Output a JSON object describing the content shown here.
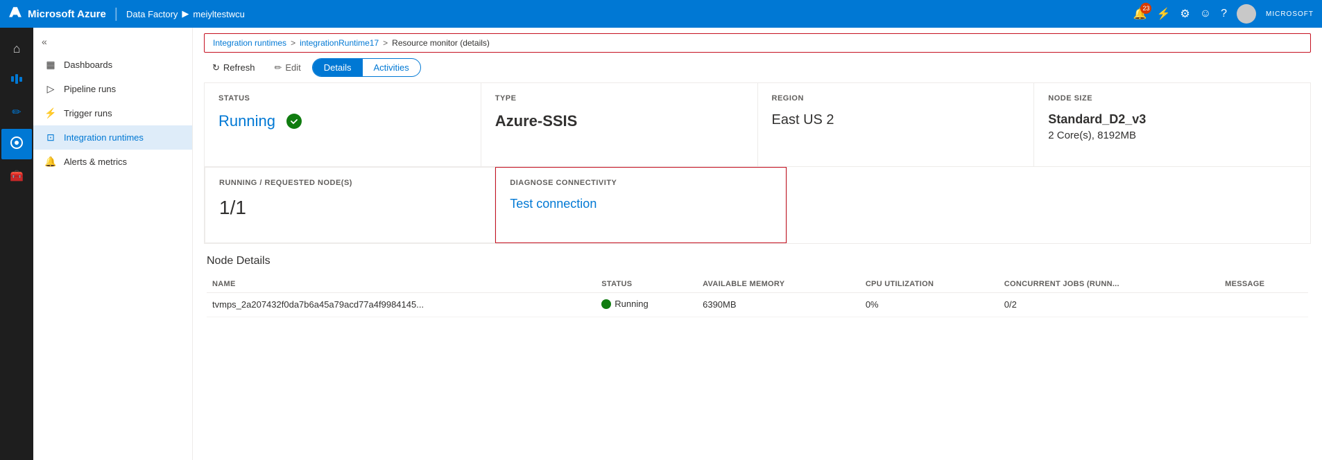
{
  "topbar": {
    "brand": "Microsoft Azure",
    "separator": "|",
    "breadcrumb1": "Data Factory",
    "arrow": "▶",
    "breadcrumb2": "meiyltestwcu",
    "notification_count": "23",
    "microsoft_label": "MICROSOFT"
  },
  "sidebar_icons": [
    {
      "id": "home",
      "label": "Home",
      "icon": "⊞",
      "active": false
    },
    {
      "id": "data-factory",
      "label": "Data Factory",
      "icon": "🏭",
      "active": false
    },
    {
      "id": "author",
      "label": "Author",
      "icon": "✏️",
      "active": false
    },
    {
      "id": "monitor",
      "label": "Monitor",
      "icon": "🔵",
      "active": true
    },
    {
      "id": "manage",
      "label": "Manage",
      "icon": "🧰",
      "active": false
    }
  ],
  "left_nav": {
    "collapse_label": "«",
    "items": [
      {
        "id": "dashboards",
        "label": "Dashboards",
        "icon": "▦",
        "active": false
      },
      {
        "id": "pipeline-runs",
        "label": "Pipeline runs",
        "icon": "▷",
        "active": false
      },
      {
        "id": "trigger-runs",
        "label": "Trigger runs",
        "icon": "⚡",
        "active": false
      },
      {
        "id": "integration-runtimes",
        "label": "Integration runtimes",
        "icon": "⊡",
        "active": true
      },
      {
        "id": "alerts-metrics",
        "label": "Alerts & metrics",
        "icon": "🔔",
        "active": false
      }
    ]
  },
  "breadcrumb": {
    "part1": "Integration runtimes",
    "sep1": ">",
    "part2": "integrationRuntime17",
    "sep2": ">",
    "part3": "Resource monitor (details)"
  },
  "toolbar": {
    "refresh_label": "Refresh",
    "edit_label": "Edit",
    "tab_details": "Details",
    "tab_activities": "Activities"
  },
  "cards": [
    {
      "id": "status",
      "label": "STATUS",
      "value": "Running",
      "type": "status-blue",
      "has_check": true
    },
    {
      "id": "type",
      "label": "TYPE",
      "value": "Azure-SSIS",
      "type": "normal-bold"
    },
    {
      "id": "region",
      "label": "REGION",
      "value": "East US 2",
      "type": "normal"
    },
    {
      "id": "node-size",
      "label": "NODE SIZE",
      "value": "Standard_D2_v3",
      "subvalue": "2 Core(s), 8192MB",
      "type": "node-size"
    }
  ],
  "cards2": [
    {
      "id": "running-nodes",
      "label": "RUNNING / REQUESTED NODE(S)",
      "value": "1/1",
      "type": "normal"
    },
    {
      "id": "diagnose",
      "label": "DIAGNOSE CONNECTIVITY",
      "value": "Test connection",
      "type": "link"
    }
  ],
  "node_details": {
    "title": "Node Details",
    "columns": [
      "NAME",
      "STATUS",
      "AVAILABLE MEMORY",
      "CPU UTILIZATION",
      "CONCURRENT JOBS (RUNN...",
      "MESSAGE"
    ],
    "rows": [
      {
        "name": "tvmps_2a207432f0da7b6a45a79acd77a4f9984145...",
        "status": "Running",
        "available_memory": "6390MB",
        "cpu_utilization": "0%",
        "concurrent_jobs": "0/2",
        "message": ""
      }
    ]
  }
}
